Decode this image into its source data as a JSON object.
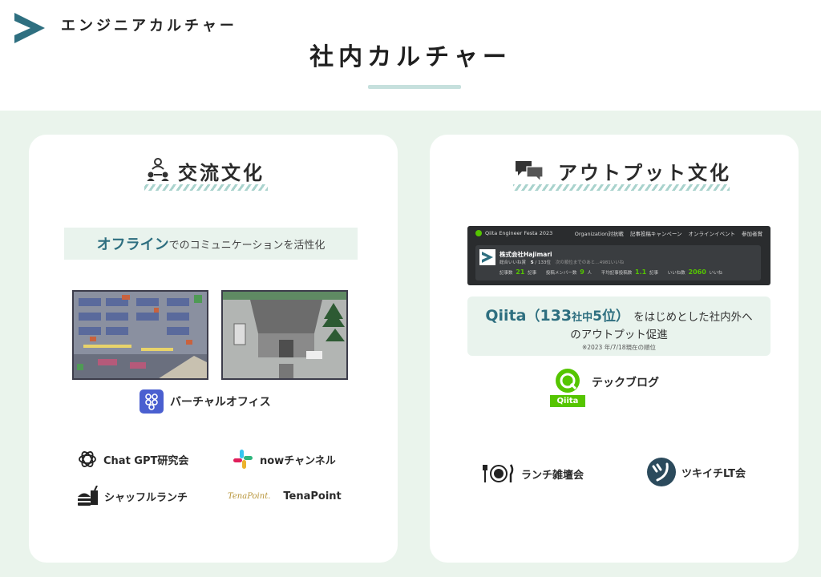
{
  "brand": {
    "name": "エンジニアカルチャー"
  },
  "page": {
    "title": "社内カルチャー"
  },
  "colors": {
    "accent": "#2e6f80",
    "background": "#eaf4ec",
    "qiita_green": "#55c500"
  },
  "exchange": {
    "title": "交流文化",
    "icon": "people-network-icon",
    "offline_strong": "オフライン",
    "offline_rest": "でのコミュニケーションを活性化",
    "virtual_office": "バーチャルオフィス",
    "items": {
      "chatgpt": "Chat GPT研究会",
      "now": "nowチャンネル",
      "shuffle": "シャッフルランチ",
      "tenapoint": "TenaPoint",
      "tenapoint_logo": "TenaPoint."
    }
  },
  "output": {
    "title": "アウトプット文化",
    "icon": "chat-bubbles-icon",
    "qiita_shot": {
      "festa": "Qiita Engineer Festa 2023",
      "nav": [
        "Organization対抗戦",
        "記事投稿キャンペーン",
        "オンラインイベント",
        "参加者賞"
      ],
      "company": "株式会社Hajimari",
      "rank_label": "総合いいね賞",
      "rank": "5",
      "rank_total": "/ 133位",
      "rank_note": "次の順位までのあと…4981いいね",
      "stats": [
        {
          "label": "記事数",
          "value": "21",
          "unit": "記事"
        },
        {
          "label": "投稿メンバー数",
          "value": "9",
          "unit": "人"
        },
        {
          "label": "平均記事投稿数",
          "value": "1.1",
          "unit": "記事"
        },
        {
          "label": "いいね数",
          "value": "2060",
          "unit": "いいね"
        }
      ]
    },
    "qiita_note": {
      "qiita": "Qiita",
      "open": "（",
      "n133": "133",
      "sha": "社中",
      "rank": "5位",
      "close": "）",
      "rest1": "をはじめとした社内外へ",
      "rest2": "のアウトプット促進",
      "footnote": "※2023 年/7/18現在の順位"
    },
    "techblog_logo": "Qiita",
    "techblog": "テックブログ",
    "lunch": "ランチ雑壇会",
    "tsukiichi": "ツキイチLT会"
  }
}
